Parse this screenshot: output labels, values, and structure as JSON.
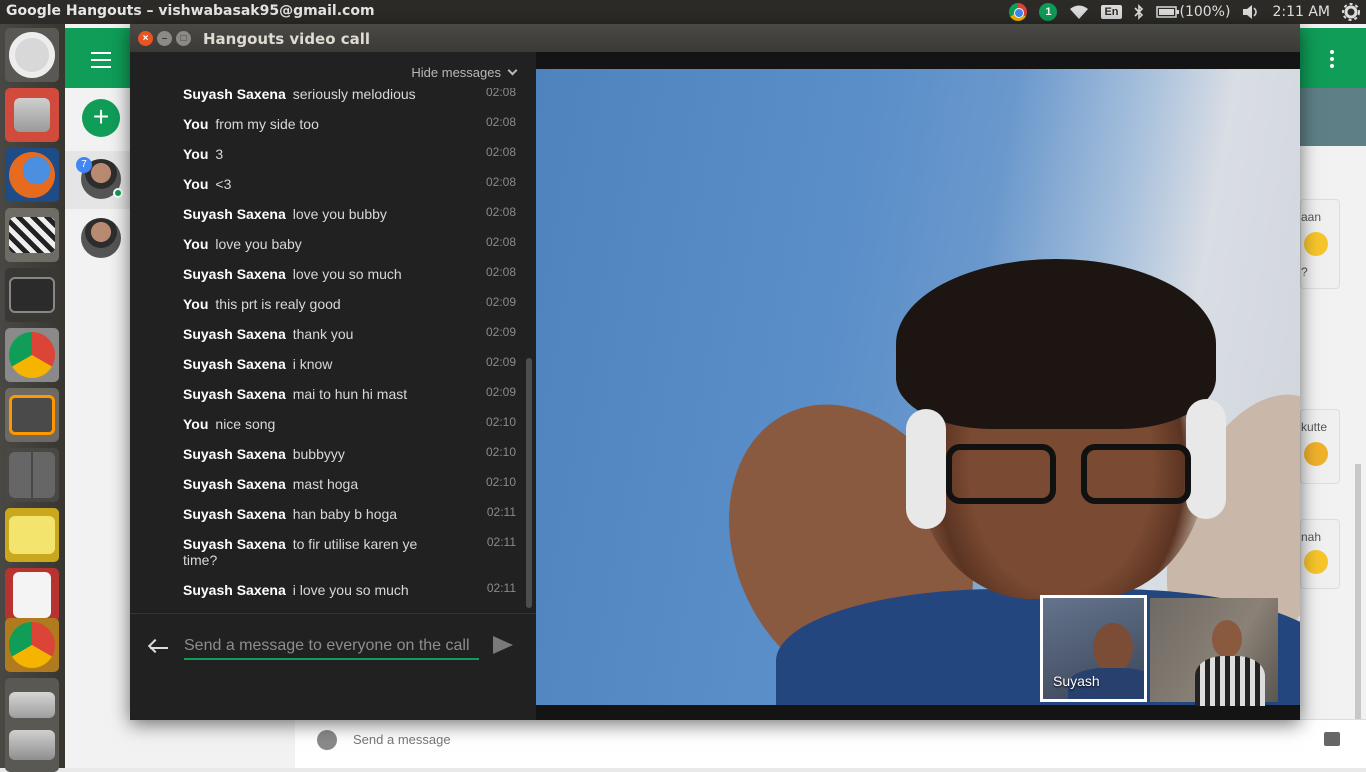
{
  "system_bar": {
    "window_title": "Google Hangouts – vishwabasak95@gmail.com",
    "notification_count": "1",
    "keyboard_layout": "En",
    "battery": "(100%)",
    "clock": "2:11 AM"
  },
  "launcher": {
    "items": [
      "ubuntu-dash-icon",
      "files-icon",
      "firefox-icon",
      "video-editor-icon",
      "terminal-icon",
      "chrome-icon",
      "sublime-text-icon",
      "workspace-switcher-icon",
      "text-editor-icon",
      "pdf-reader-icon",
      "chrome-icon",
      "drives-icon",
      "trash-icon"
    ]
  },
  "background_app": {
    "unread_count": "7",
    "compose_placeholder": "Send a message",
    "partial_messages": [
      "aan",
      "?",
      "kutte",
      "nah"
    ]
  },
  "call_window": {
    "title": "Hangouts video call",
    "hide_messages_label": "Hide messages",
    "messages": [
      {
        "sender": "Suyash Saxena",
        "text": "seriously melodious",
        "time": "02:08"
      },
      {
        "sender": "You",
        "text": "from my side too",
        "time": "02:08"
      },
      {
        "sender": "You",
        "text": "3",
        "time": "02:08"
      },
      {
        "sender": "You",
        "text": "<3",
        "time": "02:08"
      },
      {
        "sender": "Suyash Saxena",
        "text": "love you bubby",
        "time": "02:08"
      },
      {
        "sender": "You",
        "text": "love you baby",
        "time": "02:08"
      },
      {
        "sender": "Suyash Saxena",
        "text": "love you so much",
        "time": "02:08"
      },
      {
        "sender": "You",
        "text": "this prt is realy good",
        "time": "02:09"
      },
      {
        "sender": "Suyash Saxena",
        "text": "thank you",
        "time": "02:09"
      },
      {
        "sender": "Suyash Saxena",
        "text": "i know",
        "time": "02:09"
      },
      {
        "sender": "Suyash Saxena",
        "text": "mai to hun hi mast",
        "time": "02:09"
      },
      {
        "sender": "You",
        "text": "nice song",
        "time": "02:10"
      },
      {
        "sender": "Suyash Saxena",
        "text": "bubbyyy",
        "time": "02:10"
      },
      {
        "sender": "Suyash Saxena",
        "text": "mast hoga",
        "time": "02:10"
      },
      {
        "sender": "Suyash Saxena",
        "text": "han baby b hoga",
        "time": "02:11"
      },
      {
        "sender": "Suyash Saxena",
        "text": "to fir utilise karen ye time?",
        "time": "02:11"
      },
      {
        "sender": "Suyash Saxena",
        "text": "i love you so much",
        "time": "02:11"
      }
    ],
    "input_placeholder": "Send a message to everyone on the call",
    "participants": [
      {
        "name": "Suyash",
        "selected": true
      },
      {
        "name": "",
        "selected": false
      }
    ]
  }
}
